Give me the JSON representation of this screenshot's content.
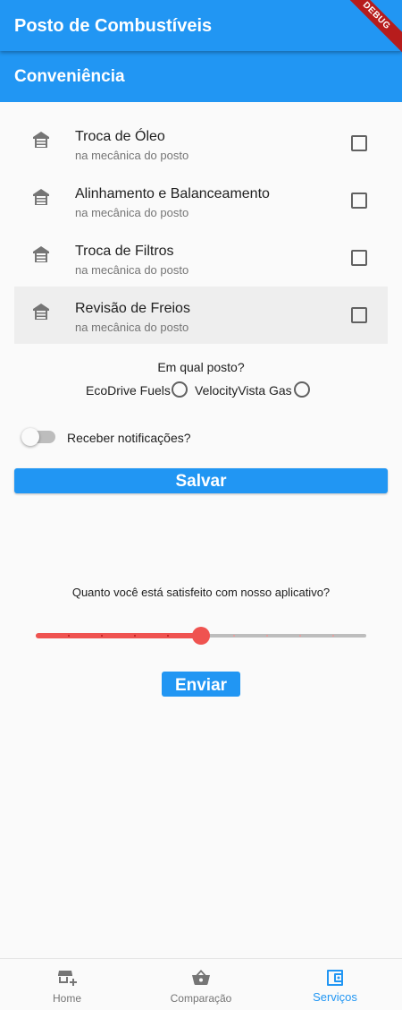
{
  "app_bar": {
    "title": "Posto de Combustíveis",
    "debug_label": "DEBUG"
  },
  "section": {
    "title": "Conveniência"
  },
  "services": [
    {
      "title": "Troca de Óleo",
      "subtitle": "na mecânica do posto",
      "checked": false
    },
    {
      "title": "Alinhamento e Balanceamento",
      "subtitle": "na mecânica do posto",
      "checked": false
    },
    {
      "title": "Troca de Filtros",
      "subtitle": "na mecânica do posto",
      "checked": false
    },
    {
      "title": "Revisão de Freios",
      "subtitle": "na mecânica do posto",
      "checked": false
    }
  ],
  "station": {
    "question": "Em qual posto?",
    "options": [
      {
        "label": "EcoDrive Fuels",
        "selected": false
      },
      {
        "label": "VelocityVista Gas",
        "selected": false
      }
    ]
  },
  "notifications": {
    "label": "Receber notificações?",
    "enabled": false
  },
  "save_button": {
    "label": "Salvar"
  },
  "rating": {
    "question": "Quanto você está satisfeito com nosso aplicativo?",
    "min": 0,
    "max": 10,
    "value": 5
  },
  "send_button": {
    "label": "Enviar"
  },
  "bottom_nav": {
    "items": [
      {
        "label": "Home",
        "icon": "store-add-icon",
        "active": false
      },
      {
        "label": "Comparação",
        "icon": "basket-icon",
        "active": false
      },
      {
        "label": "Serviços",
        "icon": "wallet-icon",
        "active": true
      }
    ]
  },
  "colors": {
    "primary": "#2196f3",
    "slider_active": "#ef5350",
    "slider_inactive": "#bdbdbd",
    "debug_banner": "#b71c1c"
  }
}
